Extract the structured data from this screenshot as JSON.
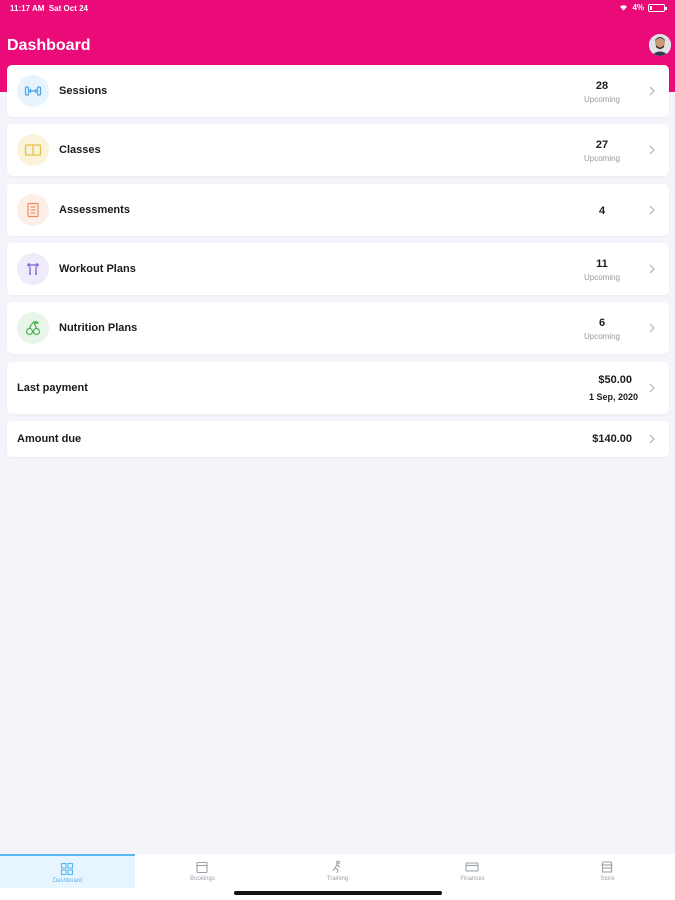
{
  "status_bar": {
    "time": "11:17 AM",
    "date": "Sat Oct 24",
    "battery": "4%"
  },
  "header": {
    "title": "Dashboard"
  },
  "cards": [
    {
      "label": "Sessions",
      "count": "28",
      "sub": "Upcoming",
      "icon": "dumbbell-icon",
      "color": "#4aa6ee",
      "bg": "#e8f4fd"
    },
    {
      "label": "Classes",
      "count": "27",
      "sub": "Upcoming",
      "icon": "book-icon",
      "color": "#e8c24a",
      "bg": "#fbf3d9"
    },
    {
      "label": "Assessments",
      "count": "4",
      "sub": "",
      "icon": "clipboard-icon",
      "color": "#f08a5a",
      "bg": "#fdeee7"
    },
    {
      "label": "Workout Plans",
      "count": "11",
      "sub": "Upcoming",
      "icon": "kettlebell-icon",
      "color": "#7b63d6",
      "bg": "#efebfb"
    },
    {
      "label": "Nutrition Plans",
      "count": "6",
      "sub": "Upcoming",
      "icon": "cherries-icon",
      "color": "#4caf50",
      "bg": "#e8f5e8"
    }
  ],
  "payment": {
    "label": "Last payment",
    "amount": "$50.00",
    "date": "1 Sep, 2020"
  },
  "due": {
    "label": "Amount due",
    "amount": "$140.00"
  },
  "tabs": [
    {
      "label": "Dashboard",
      "icon": "grid-icon",
      "active": true
    },
    {
      "label": "Bookings",
      "icon": "calendar-icon",
      "active": false
    },
    {
      "label": "Training",
      "icon": "runner-icon",
      "active": false
    },
    {
      "label": "Finances",
      "icon": "card-icon",
      "active": false
    },
    {
      "label": "Store",
      "icon": "store-icon",
      "active": false
    }
  ],
  "colors": {
    "brand": "#ea0a78",
    "active_tab": "#5ab7f0",
    "background": "#f3f5fb"
  }
}
